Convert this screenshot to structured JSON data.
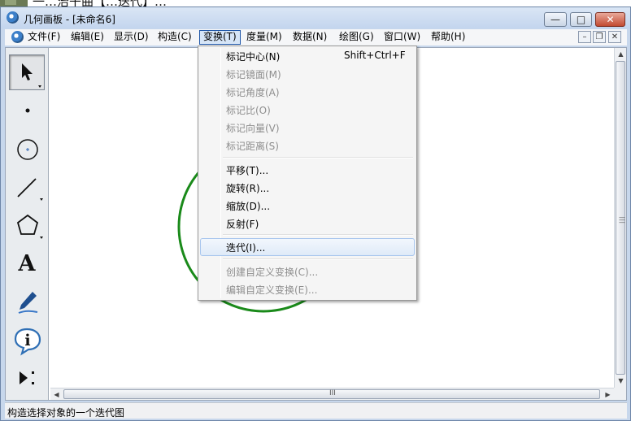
{
  "top_strip": {
    "clipped_text": "一…治干曲【…迭代】…"
  },
  "window": {
    "title": "几何画板 - [未命名6]",
    "controls": {
      "minimize": "—",
      "maximize": "□",
      "close": "✕"
    }
  },
  "menubar": {
    "items": [
      {
        "label": "文件(F)"
      },
      {
        "label": "编辑(E)"
      },
      {
        "label": "显示(D)"
      },
      {
        "label": "构造(C)"
      },
      {
        "label": "变换(T)"
      },
      {
        "label": "度量(M)"
      },
      {
        "label": "数据(N)"
      },
      {
        "label": "绘图(G)"
      },
      {
        "label": "窗口(W)"
      },
      {
        "label": "帮助(H)"
      }
    ],
    "active_menu": "变换(T)",
    "mdi_controls": {
      "minimize": "–",
      "restore": "❐",
      "close": "✕"
    }
  },
  "transform_menu": {
    "items": [
      {
        "label": "标记中心(N)",
        "shortcut": "Shift+Ctrl+F",
        "enabled": true
      },
      {
        "label": "标记镜面(M)",
        "enabled": false
      },
      {
        "label": "标记角度(A)",
        "enabled": false
      },
      {
        "label": "标记比(O)",
        "enabled": false
      },
      {
        "label": "标记向量(V)",
        "enabled": false
      },
      {
        "label": "标记距离(S)",
        "enabled": false
      },
      {
        "label": "平移(T)...",
        "enabled": true
      },
      {
        "label": "旋转(R)...",
        "enabled": true
      },
      {
        "label": "缩放(D)...",
        "enabled": true
      },
      {
        "label": "反射(F)",
        "enabled": true
      },
      {
        "label": "迭代(I)...",
        "enabled": true,
        "highlighted": true
      },
      {
        "label": "创建自定义变换(C)...",
        "enabled": false
      },
      {
        "label": "编辑自定义变换(E)...",
        "enabled": false
      }
    ]
  },
  "toolbox": {
    "tools": [
      {
        "icon": "arrow-select-icon",
        "selected": true
      },
      {
        "icon": "point-tool-icon"
      },
      {
        "icon": "compass-tool-icon"
      },
      {
        "icon": "straightedge-tool-icon"
      },
      {
        "icon": "polygon-tool-icon"
      },
      {
        "icon": "text-tool-icon",
        "glyph": "A"
      },
      {
        "icon": "marker-tool-icon"
      },
      {
        "icon": "information-tool-icon",
        "glyph": "i"
      },
      {
        "icon": "custom-tool-icon"
      }
    ]
  },
  "canvas": {
    "circle_color": "#1a8a1a"
  },
  "scrollbar": {
    "grip": "III"
  },
  "status": {
    "text": "构造选择对象的一个迭代图"
  },
  "colors": {
    "window_frame": "#c7d7ec",
    "menu_highlight": "#d6e5f7",
    "accent": "#1e56a8"
  }
}
